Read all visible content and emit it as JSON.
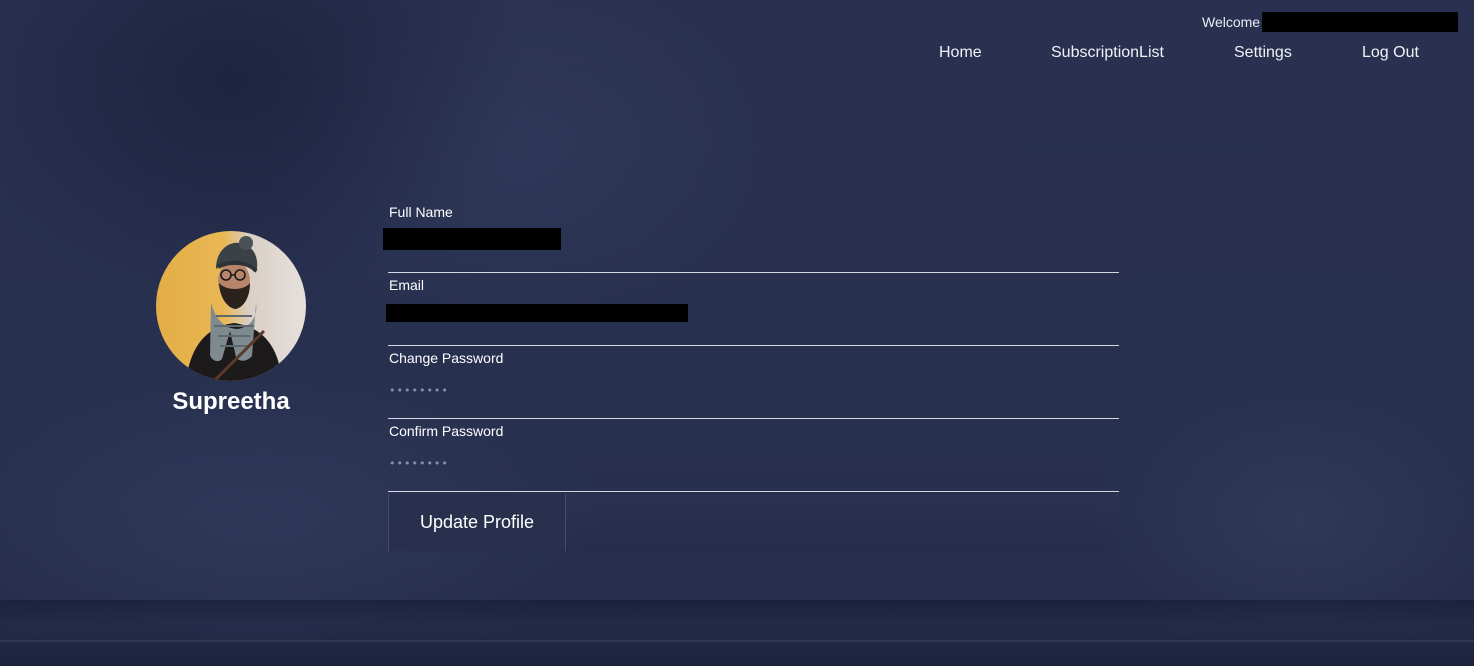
{
  "header": {
    "welcome_label": "Welcome",
    "nav": {
      "home": "Home",
      "subscription_list": "SubscriptionList",
      "settings": "Settings",
      "logout": "Log Out"
    }
  },
  "profile": {
    "name": "Supreetha"
  },
  "form": {
    "full_name_label": "Full Name",
    "email_label": "Email",
    "change_password_label": "Change Password",
    "change_password_value": "••••••••",
    "confirm_password_label": "Confirm Password",
    "confirm_password_value": "••••••••",
    "update_button": "Update Profile"
  },
  "colors": {
    "background": "#2a3150",
    "text": "#ffffff",
    "underline": "#d5d8e2",
    "redaction": "#000000"
  }
}
